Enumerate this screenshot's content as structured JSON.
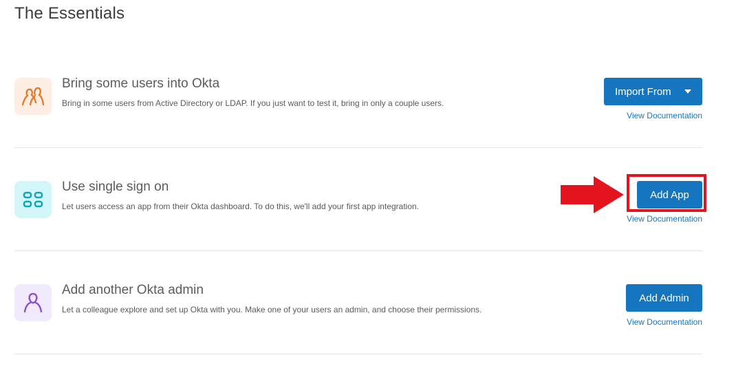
{
  "page": {
    "title": "The Essentials"
  },
  "rows": [
    {
      "icon": "users-icon",
      "icon_color": "#e87a2c",
      "tile_color": "#fdede2",
      "title": "Bring some users into Okta",
      "description": "Bring in some users from Active Directory or LDAP. If you just want to test it, bring in only a couple users.",
      "button_label": "Import From",
      "link_label": "View Documentation"
    },
    {
      "icon": "apps-grid-icon",
      "icon_color": "#11a5bd",
      "tile_color": "#d3f6f9",
      "title": "Use single sign on",
      "description": "Let users access an app from their Okta dashboard. To do this, we'll add your first app integration.",
      "button_label": "Add App",
      "link_label": "View Documentation"
    },
    {
      "icon": "admin-user-icon",
      "icon_color": "#8a4fd6",
      "tile_color": "#f1e9fc",
      "title": "Add another Okta admin",
      "description": "Let a colleague explore and set up Okta with you. Make one of your users an admin, and choose their permissions.",
      "button_label": "Add Admin",
      "link_label": "View Documentation"
    }
  ],
  "colors": {
    "primary_button": "#1575be",
    "link": "#1575be",
    "highlight": "#e3141e"
  }
}
